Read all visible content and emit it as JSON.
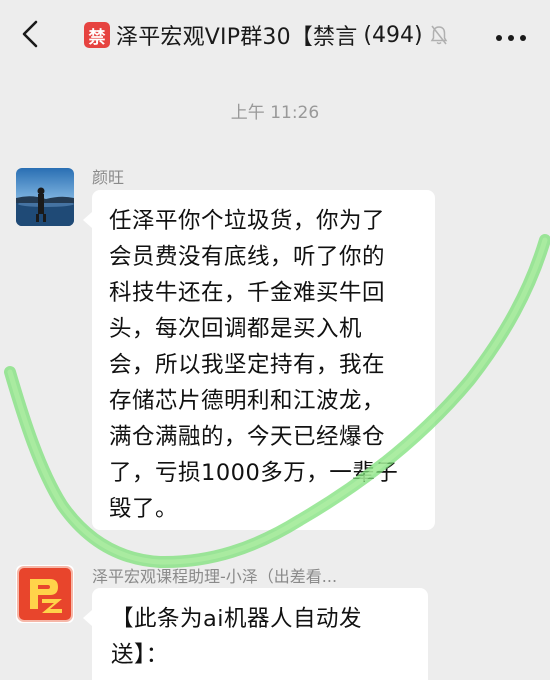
{
  "header": {
    "mute_badge": "禁",
    "title": "泽平宏观VIP群30【禁言",
    "member_count": "(494)"
  },
  "timestamp": "上午 11:26",
  "messages": [
    {
      "sender": "颜旺",
      "lines": [
        "任泽平你个垃圾货，你为了",
        "会员费没有底线，听了你的",
        "科技牛还在，千金难买牛回",
        "头，每次回调都是买入机",
        "会，所以我坚定持有，我在",
        "存储芯片德明利和江波龙，",
        "满仓满融的，今天已经爆仓",
        "了，亏损1000多万，一辈子",
        "毁了。"
      ]
    },
    {
      "sender": "泽平宏观课程助理-小泽（出差看...",
      "lines": [
        "【此条为ai机器人自动发",
        "送】："
      ]
    }
  ],
  "colors": {
    "background": "#ededed",
    "bubble": "#ffffff",
    "mute_badge": "#e64340",
    "annotation_stroke": "#7ee07a",
    "assistant_avatar": "#e8452c"
  },
  "icons": {
    "back": "chevron-left-icon",
    "muted": "bell-muted-icon",
    "more": "more-dots-icon"
  }
}
